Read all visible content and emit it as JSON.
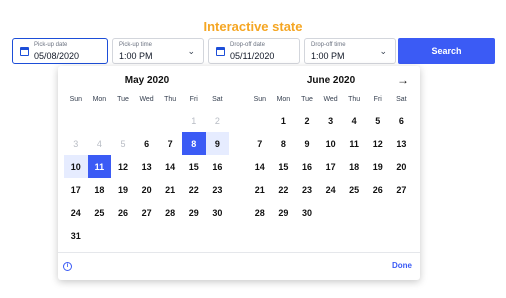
{
  "header": {
    "title": "Interactive state"
  },
  "pickup_date": {
    "label": "Pick-up date",
    "value": "05/08/2020",
    "icon": "calendar-icon"
  },
  "pickup_time": {
    "label": "Pick-up time",
    "value": "1:00 PM",
    "icon": "chevron-down-icon"
  },
  "dropoff_date": {
    "label": "Drop-off date",
    "value": "05/11/2020",
    "icon": "calendar-icon"
  },
  "dropoff_time": {
    "label": "Drop-off time",
    "value": "1:00 PM",
    "icon": "chevron-down-icon"
  },
  "search": {
    "label": "Search"
  },
  "colors": {
    "accent": "#3b5bf5",
    "range": "#e6ecff",
    "title": "#f5a623",
    "active_border": "#1d4ed8"
  },
  "calendar": {
    "next_arrow": "→",
    "weekdays": [
      "Sun",
      "Mon",
      "Tue",
      "Wed",
      "Thu",
      "Fri",
      "Sat"
    ],
    "months": [
      {
        "title": "May 2020",
        "weeks": [
          [
            {
              "d": ""
            },
            {
              "d": ""
            },
            {
              "d": ""
            },
            {
              "d": ""
            },
            {
              "d": ""
            },
            {
              "d": "1",
              "s": "disabled"
            },
            {
              "d": "2",
              "s": "disabled"
            }
          ],
          [
            {
              "d": "3",
              "s": "disabled"
            },
            {
              "d": "4",
              "s": "disabled"
            },
            {
              "d": "5",
              "s": "disabled"
            },
            {
              "d": "6"
            },
            {
              "d": "7"
            },
            {
              "d": "8",
              "s": "selected"
            },
            {
              "d": "9",
              "s": "range"
            }
          ],
          [
            {
              "d": "10",
              "s": "range"
            },
            {
              "d": "11",
              "s": "selected"
            },
            {
              "d": "12"
            },
            {
              "d": "13"
            },
            {
              "d": "14"
            },
            {
              "d": "15"
            },
            {
              "d": "16"
            }
          ],
          [
            {
              "d": "17"
            },
            {
              "d": "18"
            },
            {
              "d": "19"
            },
            {
              "d": "20"
            },
            {
              "d": "21"
            },
            {
              "d": "22"
            },
            {
              "d": "23"
            }
          ],
          [
            {
              "d": "24"
            },
            {
              "d": "25"
            },
            {
              "d": "26"
            },
            {
              "d": "27"
            },
            {
              "d": "28"
            },
            {
              "d": "29"
            },
            {
              "d": "30"
            }
          ],
          [
            {
              "d": "31"
            },
            {
              "d": ""
            },
            {
              "d": ""
            },
            {
              "d": ""
            },
            {
              "d": ""
            },
            {
              "d": ""
            },
            {
              "d": ""
            }
          ]
        ]
      },
      {
        "title": "June 2020",
        "weeks": [
          [
            {
              "d": ""
            },
            {
              "d": "1"
            },
            {
              "d": "2"
            },
            {
              "d": "3"
            },
            {
              "d": "4"
            },
            {
              "d": "5"
            },
            {
              "d": "6"
            }
          ],
          [
            {
              "d": "7"
            },
            {
              "d": "8"
            },
            {
              "d": "9"
            },
            {
              "d": "10"
            },
            {
              "d": "11"
            },
            {
              "d": "12"
            },
            {
              "d": "13"
            }
          ],
          [
            {
              "d": "14"
            },
            {
              "d": "15"
            },
            {
              "d": "16"
            },
            {
              "d": "17"
            },
            {
              "d": "18"
            },
            {
              "d": "19"
            },
            {
              "d": "20"
            }
          ],
          [
            {
              "d": "21"
            },
            {
              "d": "22"
            },
            {
              "d": "23"
            },
            {
              "d": "24"
            },
            {
              "d": "25"
            },
            {
              "d": "26"
            },
            {
              "d": "27"
            }
          ],
          [
            {
              "d": "28"
            },
            {
              "d": "29"
            },
            {
              "d": "30"
            },
            {
              "d": ""
            },
            {
              "d": ""
            },
            {
              "d": ""
            },
            {
              "d": ""
            }
          ]
        ]
      }
    ],
    "footer": {
      "info_icon": "info-icon",
      "info_glyph": "i",
      "done_label": "Done"
    }
  }
}
